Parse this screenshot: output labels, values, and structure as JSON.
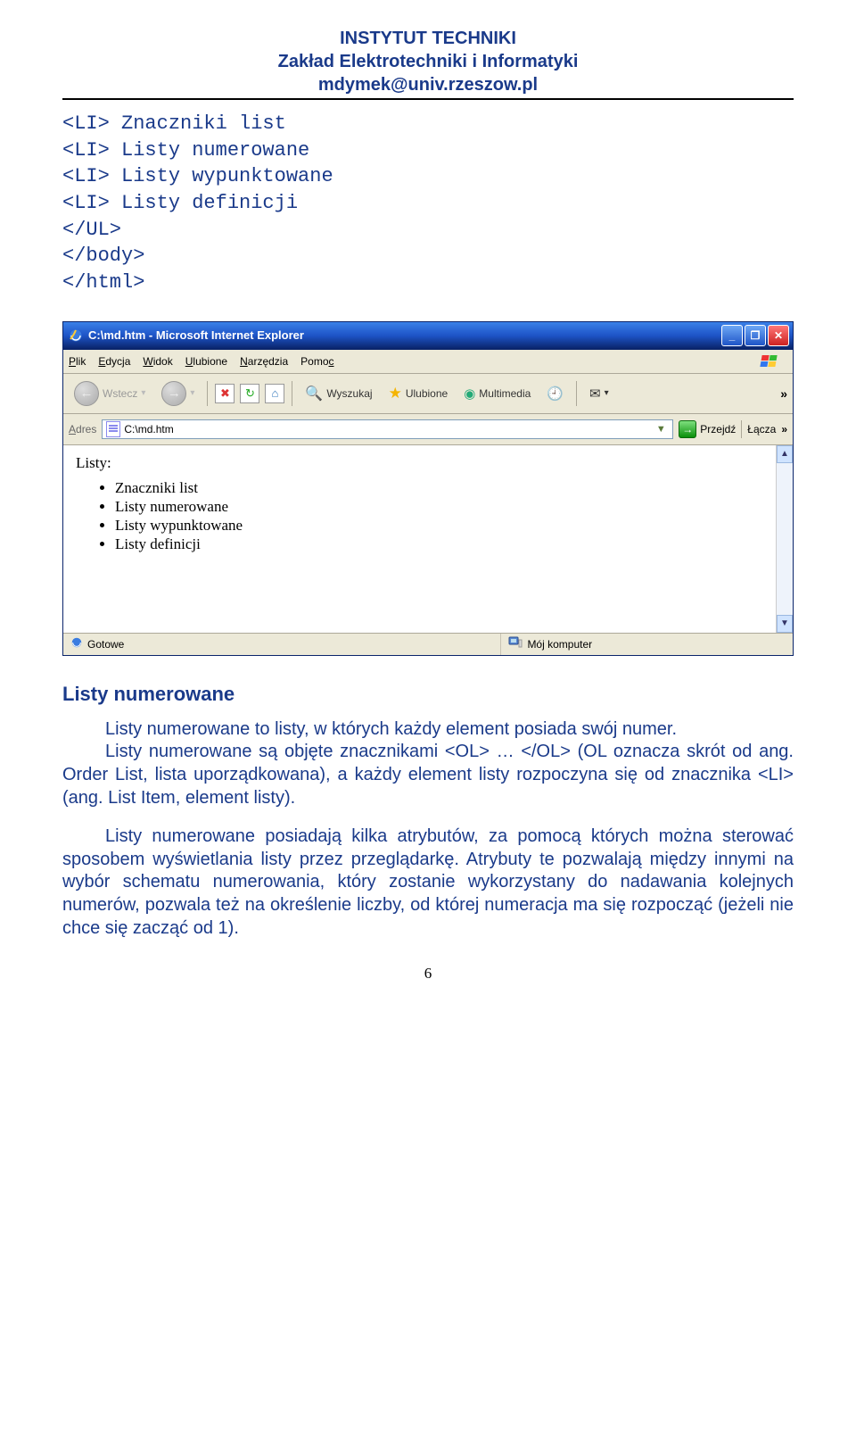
{
  "header": {
    "line1": "INSTYTUT TECHNIKI",
    "line2": "Zakład Elektrotechniki i Informatyki",
    "email": "mdymek@univ.rzeszow.pl"
  },
  "code_block": "<LI> Znaczniki list\n<LI> Listy numerowane\n<LI> Listy wypunktowane\n<LI> Listy definicji\n</UL>\n</body>\n</html>",
  "browser": {
    "title": "C:\\md.htm - Microsoft Internet Explorer",
    "menu": {
      "file": "Plik",
      "edit": "Edycja",
      "view": "Widok",
      "favorites": "Ulubione",
      "tools": "Narzędzia",
      "help": "Pomoc"
    },
    "toolbar": {
      "back": "Wstecz",
      "search": "Wyszukaj",
      "favorites": "Ulubione",
      "media": "Multimedia",
      "overflow": "»"
    },
    "address": {
      "label": "Adres",
      "value": "C:\\md.htm",
      "go": "Przejdź",
      "links": "Łącza",
      "overflow": "»"
    },
    "page": {
      "heading": "Listy:",
      "items": [
        "Znaczniki list",
        "Listy numerowane",
        "Listy wypunktowane",
        "Listy definicji"
      ]
    },
    "status": {
      "left": "Gotowe",
      "right": "Mój komputer"
    }
  },
  "article": {
    "h2": "Listy numerowane",
    "p1": "Listy numerowane to listy, w których każdy element posiada swój numer.",
    "p2": "Listy numerowane są objęte znacznikami <OL> … </OL> (OL oznacza skrót od ang. Order List, lista uporządkowana), a każdy element listy rozpoczyna się od znacznika <LI> (ang. List Item, element listy).",
    "p3": "Listy numerowane posiadają kilka atrybutów, za pomocą których można sterować sposobem wyświetlania listy przez przeglądarkę. Atrybuty te pozwalają między innymi na wybór schematu numerowania, który zostanie wykorzystany do nadawania kolejnych numerów, pozwala też na określenie liczby, od której numeracja ma się rozpocząć (jeżeli nie chce się zacząć od 1)."
  },
  "page_number": "6"
}
